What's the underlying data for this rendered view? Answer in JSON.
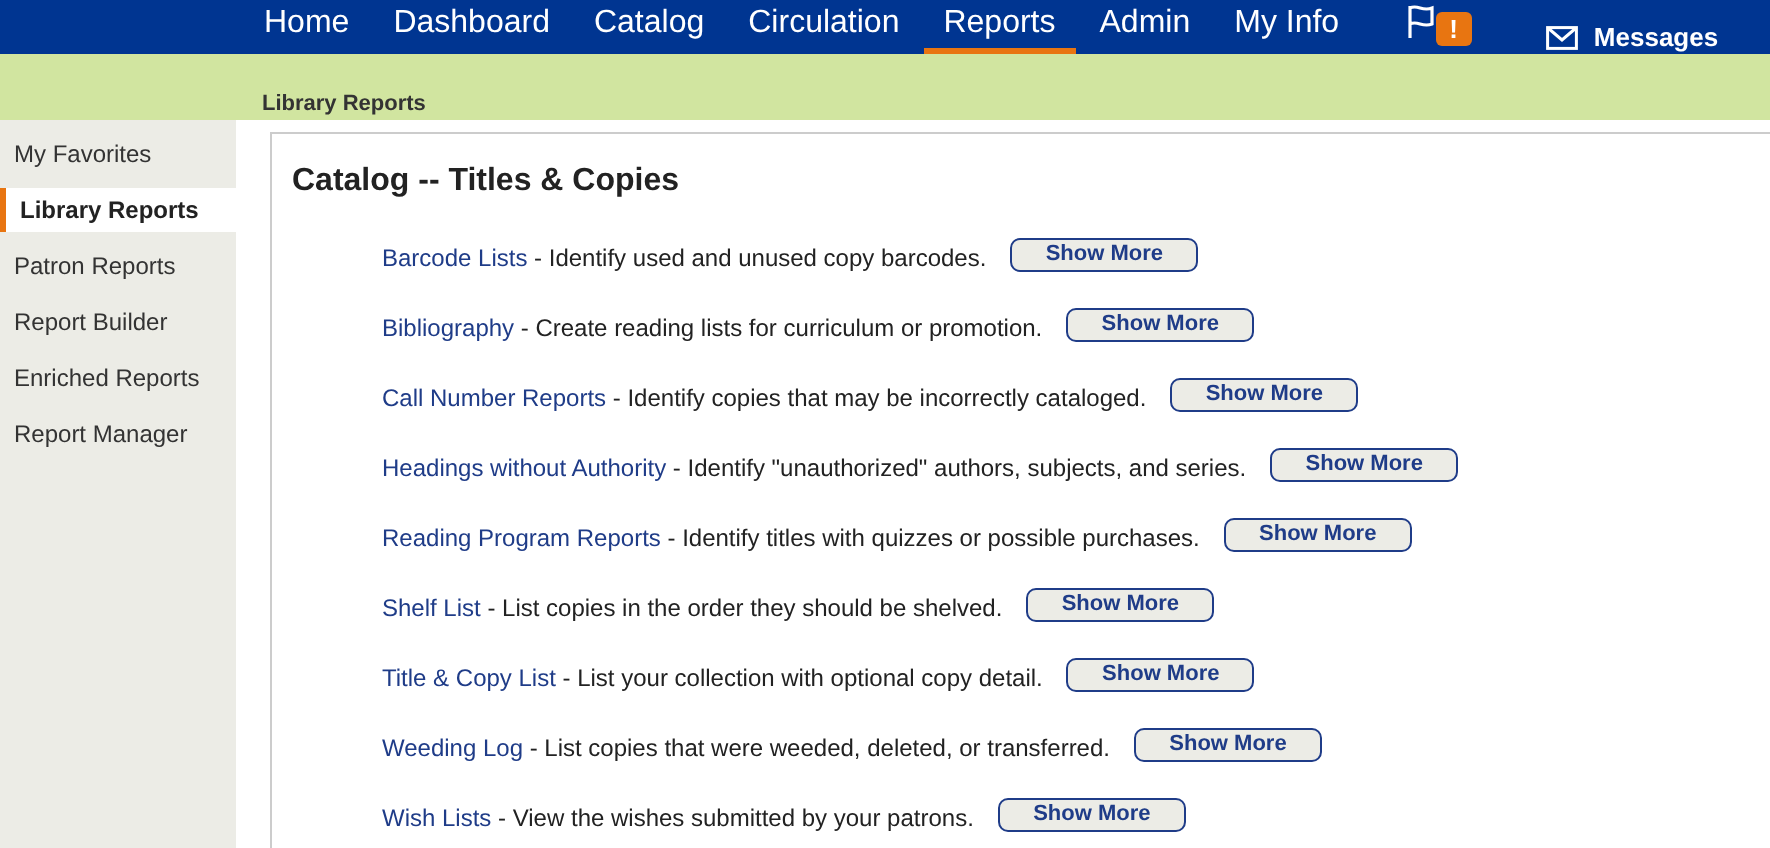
{
  "nav": {
    "items": [
      {
        "label": "Home",
        "selected": false
      },
      {
        "label": "Dashboard",
        "selected": false
      },
      {
        "label": "Catalog",
        "selected": false
      },
      {
        "label": "Circulation",
        "selected": false
      },
      {
        "label": "Reports",
        "selected": true
      },
      {
        "label": "Admin",
        "selected": false
      },
      {
        "label": "My Info",
        "selected": false
      }
    ],
    "alert_badge": "!",
    "messages": "Messages"
  },
  "breadcrumb": "Library Reports",
  "sidebar": {
    "items": [
      {
        "label": "My Favorites",
        "selected": false
      },
      {
        "label": "Library Reports",
        "selected": true
      },
      {
        "label": "Patron Reports",
        "selected": false
      },
      {
        "label": "Report Builder",
        "selected": false
      },
      {
        "label": "Enriched Reports",
        "selected": false
      },
      {
        "label": "Report Manager",
        "selected": false
      }
    ]
  },
  "section": {
    "title": "Catalog -- Titles & Copies",
    "reports": [
      {
        "name": "Barcode Lists",
        "description": " - Identify used and unused copy barcodes.",
        "button": "Show More"
      },
      {
        "name": "Bibliography",
        "description": " - Create reading lists for curriculum or promotion.",
        "button": "Show More"
      },
      {
        "name": "Call Number Reports",
        "description": " - Identify copies that may be incorrectly cataloged.",
        "button": "Show More"
      },
      {
        "name": "Headings without Authority",
        "description": " - Identify \"unauthorized\" authors, subjects, and series.",
        "button": "Show More"
      },
      {
        "name": "Reading Program Reports",
        "description": " - Identify titles with quizzes or possible purchases.",
        "button": "Show More"
      },
      {
        "name": "Shelf List",
        "description": " - List copies in the order they should be shelved.",
        "button": "Show More"
      },
      {
        "name": "Title & Copy List",
        "description": " - List your collection with optional copy detail.",
        "button": "Show More"
      },
      {
        "name": "Weeding Log",
        "description": " - List copies that were weeded, deleted, or transferred.",
        "button": "Show More"
      },
      {
        "name": "Wish Lists",
        "description": " - View the wishes submitted by your patrons.",
        "button": "Show More"
      }
    ]
  }
}
